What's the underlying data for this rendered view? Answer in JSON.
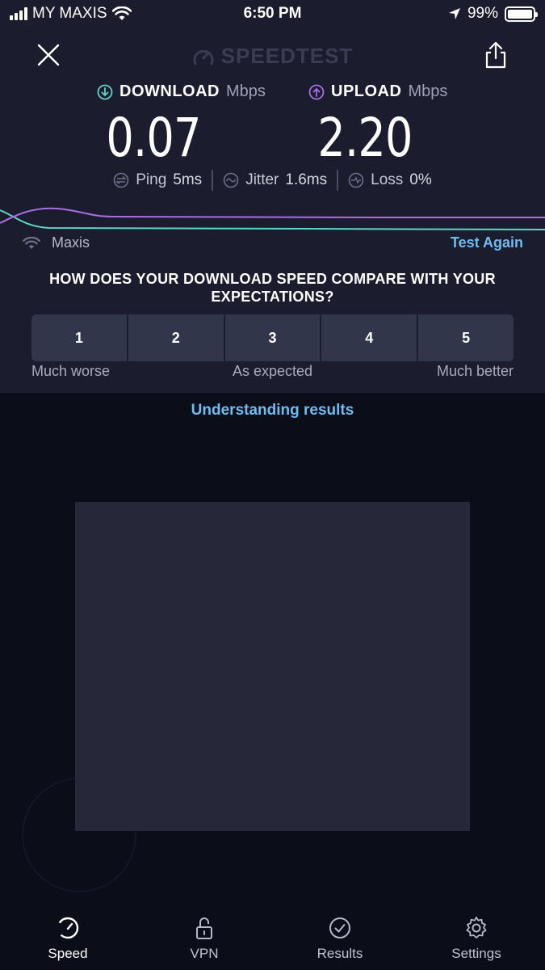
{
  "status_bar": {
    "carrier": "MY MAXIS",
    "time": "6:50 PM",
    "battery": "99%",
    "battery_level": 0.99
  },
  "header": {
    "brand": "SPEEDTEST",
    "close_icon": "close-icon",
    "share_icon": "share-icon"
  },
  "download": {
    "label": "DOWNLOAD",
    "unit": "Mbps",
    "value": "0.07"
  },
  "upload": {
    "label": "UPLOAD",
    "unit": "Mbps",
    "value": "2.20"
  },
  "stats": {
    "ping": {
      "label": "Ping",
      "value": "5ms"
    },
    "jitter": {
      "label": "Jitter",
      "value": "1.6ms"
    },
    "loss": {
      "label": "Loss",
      "value": "0%"
    }
  },
  "connection": {
    "isp": "Maxis",
    "test_again": "Test Again"
  },
  "survey": {
    "question": "HOW DOES YOUR DOWNLOAD SPEED COMPARE WITH YOUR EXPECTATIONS?",
    "options": [
      "1",
      "2",
      "3",
      "4",
      "5"
    ],
    "label_low": "Much worse",
    "label_mid": "As expected",
    "label_high": "Much better"
  },
  "links": {
    "understanding": "Understanding results"
  },
  "tabs": [
    {
      "label": "Speed",
      "icon": "speedometer-icon",
      "active": true
    },
    {
      "label": "VPN",
      "icon": "lock-icon",
      "active": false
    },
    {
      "label": "Results",
      "icon": "checkmark-icon",
      "active": false
    },
    {
      "label": "Settings",
      "icon": "gear-icon",
      "active": false
    }
  ],
  "colors": {
    "download_accent": "#5fd3c4",
    "upload_accent": "#a56fe0",
    "link": "#6fbcf0",
    "background_top": "#1b1d2e",
    "background_bottom": "#0b0d19"
  }
}
